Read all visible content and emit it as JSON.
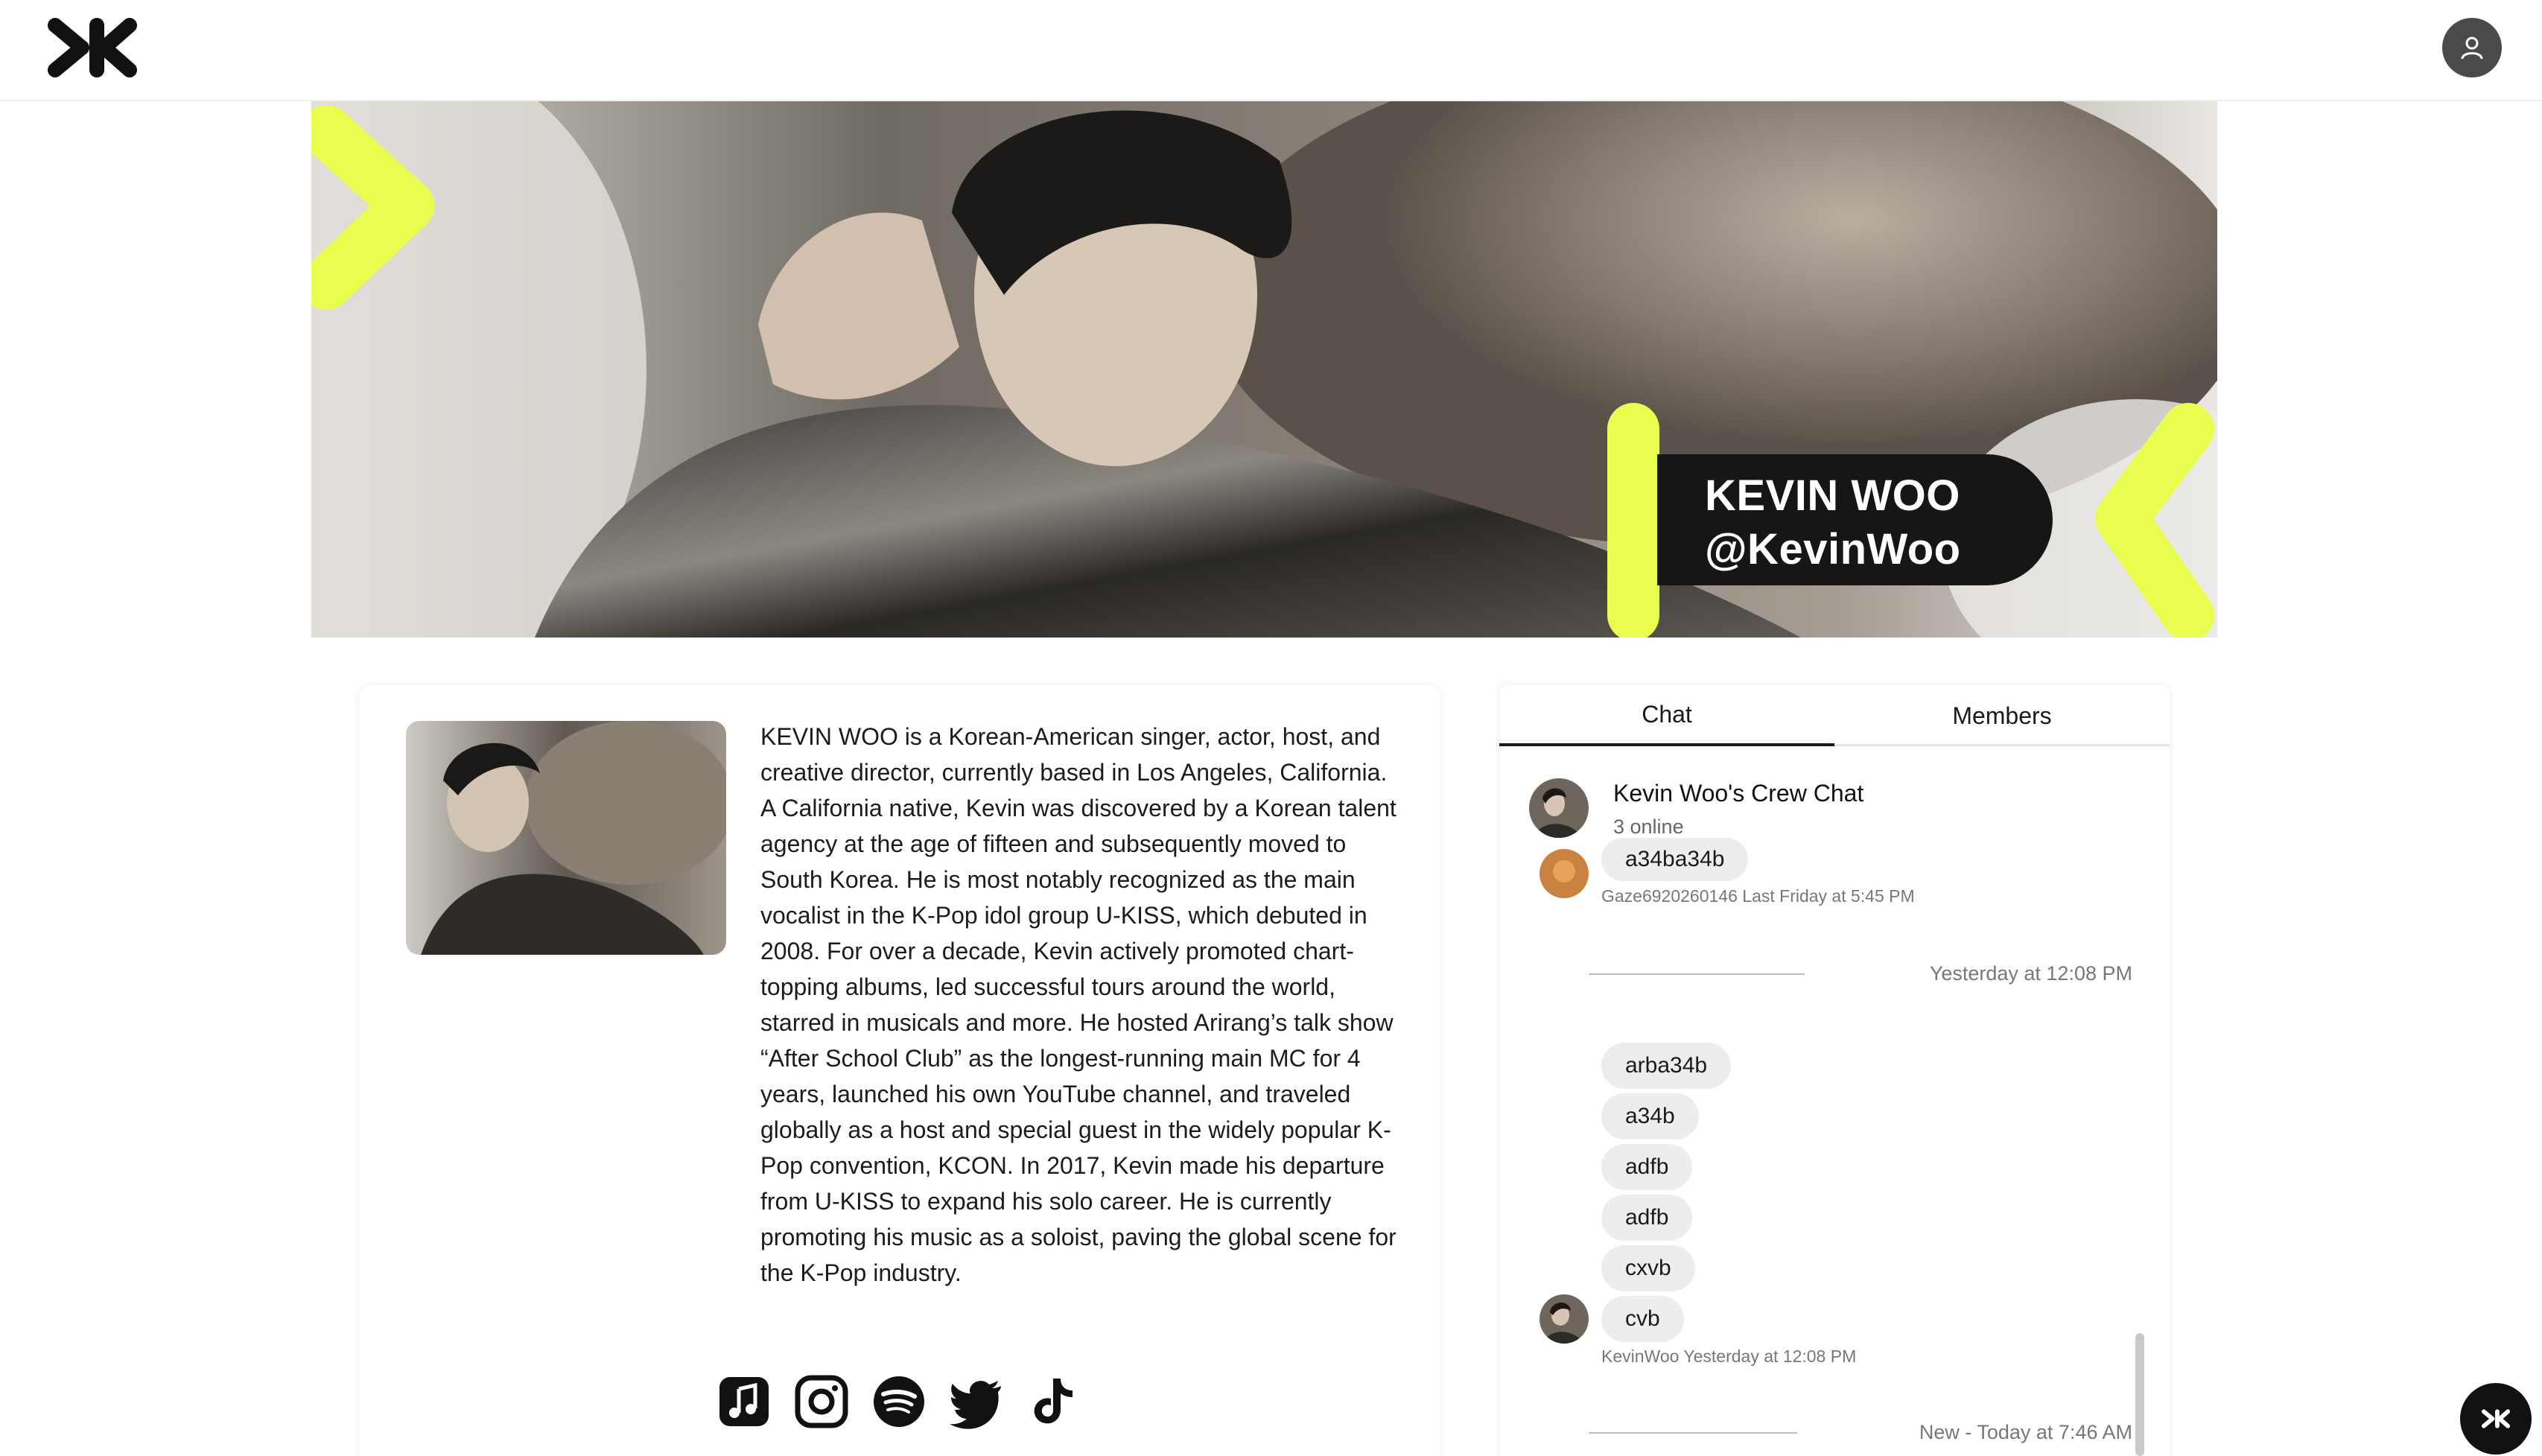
{
  "app": {
    "brand_icon": "kk-logo-icon"
  },
  "header": {
    "account_icon": "user-icon"
  },
  "artist": {
    "name": "KEVIN WOO",
    "handle": "@KevinWoo",
    "bio": "KEVIN WOO is a Korean-American singer, actor, host, and creative director, currently based in Los Angeles, California. A California native, Kevin was discovered by a Korean talent agency at the age of fifteen and subsequently moved to South Korea. He is most notably recognized as the main vocalist in the K-Pop idol group U-KISS, which debuted in 2008. For over a decade, Kevin actively promoted chart-topping albums, led successful tours around the world, starred in musicals and more. He hosted Arirang’s talk show “After School Club” as the longest-running main MC for 4 years, launched his own YouTube channel, and traveled globally as a host and special guest in the widely popular K-Pop convention, KCON. In 2017, Kevin made his departure from U-KISS to expand his solo career. He is currently promoting his music as a soloist, paving the global scene for the K-Pop industry.",
    "socials": [
      "apple-music-icon",
      "instagram-icon",
      "spotify-icon",
      "twitter-icon",
      "tiktok-icon"
    ]
  },
  "colors": {
    "accent": "#e9fd4f",
    "dark": "#161616",
    "bubble": "#ededed"
  },
  "chat": {
    "tabs": [
      "Chat",
      "Members"
    ],
    "active_tab": "Chat",
    "title": "Kevin Woo's Crew Chat",
    "online": "3 online",
    "messages": {
      "top_bubble": "a34ba34b",
      "top_meta": "Gaze6920260146 Last Friday at 5:45 PM",
      "separator_1": "Yesterday at 12:08 PM",
      "bubbles": [
        "arba34b",
        "a34b",
        "adfb",
        "adfb",
        "cxvb",
        "cvb"
      ],
      "group_meta": "KevinWoo Yesterday at 12:08 PM",
      "separator_2": "New - Today at 7:46 AM"
    }
  },
  "fab": {
    "icon": "kk-logo-icon"
  }
}
